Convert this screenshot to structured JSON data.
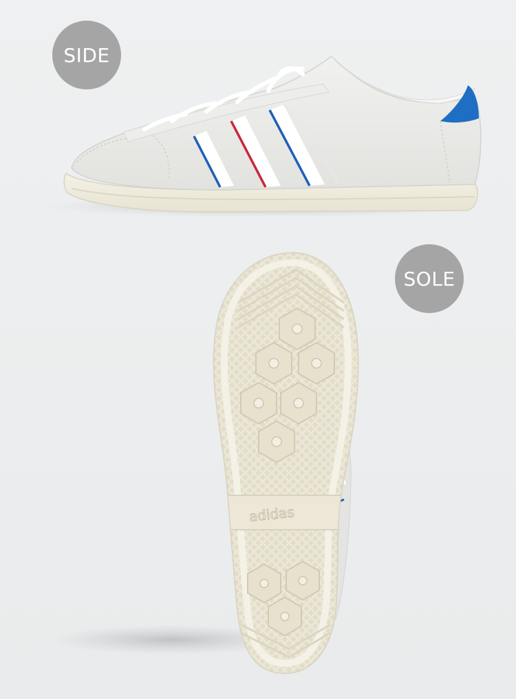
{
  "badges": {
    "side": "SIDE",
    "sole": "SOLE"
  },
  "sole_brand": "adidas",
  "colors": {
    "background": "#ebeced",
    "suede": "#e6e6e4",
    "midsole": "#efece1",
    "stripe_blue": "#1f5fb8",
    "stripe_red": "#c7283a",
    "heel_tab": "#1e6fc4",
    "badge": "#a5a5a6"
  }
}
